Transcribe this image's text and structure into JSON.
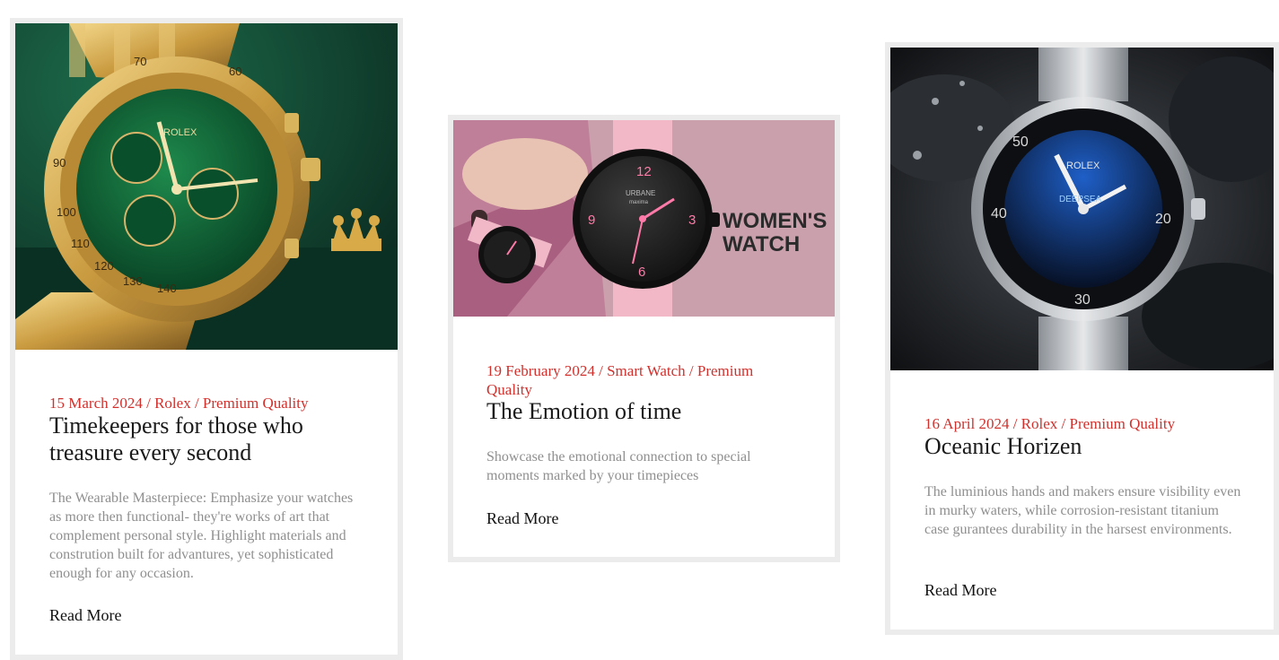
{
  "cards": [
    {
      "meta": "15 March 2024 / Rolex / Premium Quality",
      "title": "Timekeepers for those who treasure every second",
      "description": "The Wearable Masterpiece: Emphasize your watches as more then functional- they're works of art that complement personal style. Highlight materials and constrution built for advantures, yet sophisticated enough for any occasion.",
      "read_more": "Read More",
      "image": {
        "name": "gold-green-chronograph-image",
        "dial_brand": "ROLEX",
        "bezel_numbers": [
          "70",
          "60",
          "90",
          "100",
          "110",
          "120",
          "130",
          "140"
        ]
      }
    },
    {
      "meta": "19 February 2024 / Smart Watch / Premium Quality",
      "title": "The Emotion of time",
      "description": "Showcase the emotional connection to special moments marked by your timepieces",
      "read_more": "Read More",
      "image": {
        "name": "womens-watch-banner-image",
        "banner_line1": "WOMEN'S",
        "banner_line2": "WATCH",
        "dial_brand": "URBANE",
        "dial_sub": "maxima",
        "dial_numbers": [
          "12",
          "3",
          "6",
          "9"
        ]
      }
    },
    {
      "meta": "16 April 2024 / Rolex / Premium Quality",
      "title": "Oceanic Horizen",
      "description": "The luminious hands and makers ensure visibility even in murky waters, while corrosion-resistant titanium case gurantees durability in the harsest environments.",
      "read_more": "Read More",
      "image": {
        "name": "deepsea-diver-image",
        "dial_brand": "ROLEX",
        "dial_model": "DEEPSEA",
        "bezel_numbers": [
          "50",
          "40",
          "30",
          "20"
        ]
      }
    }
  ]
}
